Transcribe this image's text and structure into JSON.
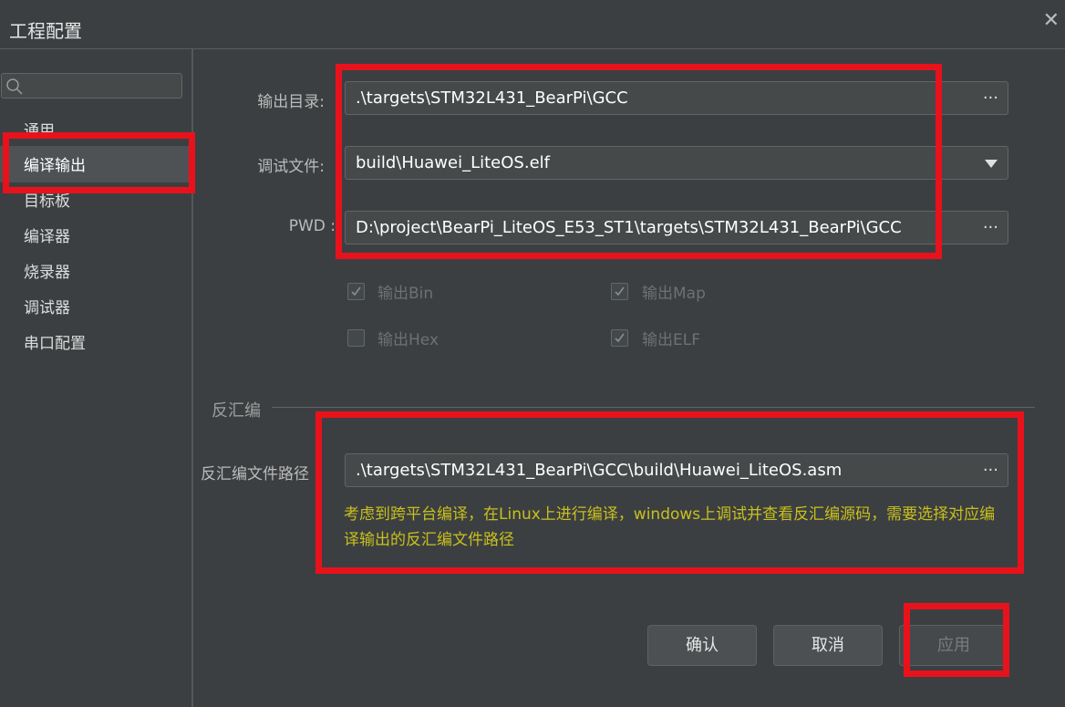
{
  "window": {
    "title": "工程配置",
    "close_glyph": "✕"
  },
  "sidebar": {
    "search_placeholder": "",
    "items": [
      {
        "label": "通用"
      },
      {
        "label": "编译输出",
        "active": true
      },
      {
        "label": "目标板"
      },
      {
        "label": "编译器"
      },
      {
        "label": "烧录器"
      },
      {
        "label": "调试器"
      },
      {
        "label": "串口配置"
      }
    ]
  },
  "form": {
    "output_dir": {
      "label": "输出目录:",
      "value": ".\\targets\\STM32L431_BearPi\\GCC",
      "button": "···"
    },
    "debug_file": {
      "label": "调试文件:",
      "value": "build\\Huawei_LiteOS.elf"
    },
    "pwd": {
      "label": "PWD :",
      "value": "D:\\project\\BearPi_LiteOS_E53_ST1\\targets\\STM32L431_BearPi\\GCC",
      "button": "···"
    },
    "checkboxes": [
      {
        "label": "输出Bin",
        "checked": true
      },
      {
        "label": "输出Map",
        "checked": true
      },
      {
        "label": "输出Hex",
        "checked": false
      },
      {
        "label": "输出ELF",
        "checked": true
      }
    ]
  },
  "disasm": {
    "group_title": "反汇编",
    "path_label": "反汇编文件路径",
    "path_value": ".\\targets\\STM32L431_BearPi\\GCC\\build\\Huawei_LiteOS.asm",
    "button": "···",
    "hint": "考虑到跨平台编译，在Linux上进行编译，windows上调试并查看反汇编源码，需要选择对应编译输出的反汇编文件路径"
  },
  "buttons": {
    "ok": "确认",
    "cancel": "取消",
    "apply": "应用"
  },
  "colors": {
    "highlight_box": "#e8121c",
    "hint_text": "#c8c01c",
    "background": "#3c3f41"
  }
}
